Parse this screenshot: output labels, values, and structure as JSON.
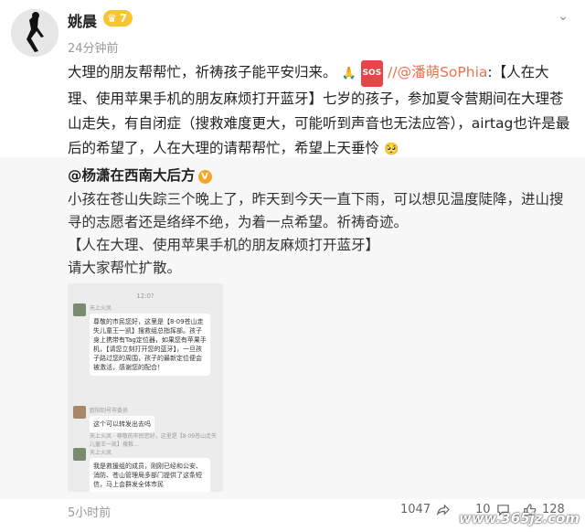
{
  "post": {
    "username": "姚晨",
    "vip_level": "7",
    "timestamp": "24分钟前",
    "text_1": "大理的朋友帮帮忙，祈祷孩子能平安归来。",
    "sos_label": "SOS",
    "mention": "//@潘萌SoPhia",
    "text_2": ":【人在大理、使用苹果手机的朋友麻烦打开蓝牙】七岁的孩子，参加夏令营期间在大理苍山走失，有自闭症（搜救难度更大，可能听到声音也无法应答），airtag也许是最后的希望了，人在大理的请帮帮忙，希望上天垂怜"
  },
  "repost": {
    "author": "@杨潇在西南大后方",
    "text_1": "小孩在苍山失踪三个晚上了，昨天到今天一直下雨，可以想见温度陡降，进山搜寻的志愿者还是络绎不绝，为着一点希望。祈祷奇迹。",
    "text_2": "【人在大理、使用苹果手机的朋友麻烦打开蓝牙】",
    "text_3": "请大家帮忙扩散。",
    "chat": {
      "time": "12:0?",
      "msg1_name": "天上火凤",
      "msg1_text": "尊敬的市民您好，这里是【8·09苍山走失儿童王一凯】搜救组总指挥部。孩子身上携带有Tag定位器，如果您有苹果手机，【请您立刻打开您的蓝牙】，一旦孩子路过您的周围，孩子的最新定位便会被激活，感谢您的配合！",
      "msg2_name": "欧阳钊号市委员",
      "msg2_text": "这个可以转发出去吗",
      "msg3_name": "天上火凤 · 尊敬的市民您好，这里是【8·09苍山走失儿童王一凯】搜救...",
      "msg4_name": "天上火凤",
      "msg4_text": "我是救援组的成员，刚刚已经和公安、消防、苍山管理局多部门提供了这条短信，马上会群发全体市民"
    }
  },
  "footer": {
    "time": "5小时前",
    "reposts": "1047",
    "comments": "10",
    "likes": "128"
  },
  "watermark": "www.365jz.com"
}
